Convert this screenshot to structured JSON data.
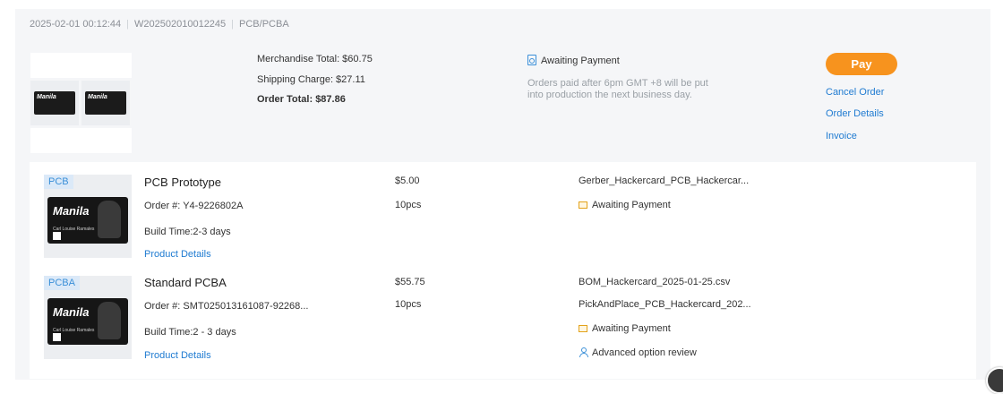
{
  "order": {
    "date": "2025-02-01 00:12:44",
    "number": "W202502010012245",
    "category": "PCB/PCBA",
    "merchandise_total": "Merchandise Total: $60.75",
    "shipping_charge": "Shipping Charge: $27.11",
    "order_total": "Order Total: $87.86",
    "status": "Awaiting Payment",
    "status_note": "Orders paid after 6pm GMT +8 will be put into production the next business day.",
    "actions": {
      "pay": "Pay",
      "cancel": "Cancel Order",
      "details": "Order Details",
      "invoice": "Invoice"
    },
    "board_brand": "Manila"
  },
  "items": [
    {
      "tag": "PCB",
      "name": "PCB Prototype",
      "order_no": "Order #: Y4-9226802A",
      "build_time": "Build Time:2-3 days",
      "details_link": "Product Details",
      "price": "$5.00",
      "qty": "10pcs",
      "files": [
        "Gerber_Hackercard_PCB_Hackercar..."
      ],
      "status": "Awaiting Payment"
    },
    {
      "tag": "PCBA",
      "name": "Standard PCBA",
      "order_no": "Order #: SMT025013161087-92268...",
      "build_time": "Build Time:2 - 3 days",
      "details_link": "Product Details",
      "price": "$55.75",
      "qty": "10pcs",
      "files": [
        "BOM_Hackercard_2025-01-25.csv",
        "PickAndPlace_PCB_Hackercard_202..."
      ],
      "status": "Awaiting Payment",
      "extra_status": "Advanced option review"
    }
  ],
  "pcb_card_text": "Carl Louise Ramales",
  "colors": {
    "accent": "#f7931e",
    "link": "#1f7bd1",
    "tag_bg": "#dbe9f8"
  }
}
